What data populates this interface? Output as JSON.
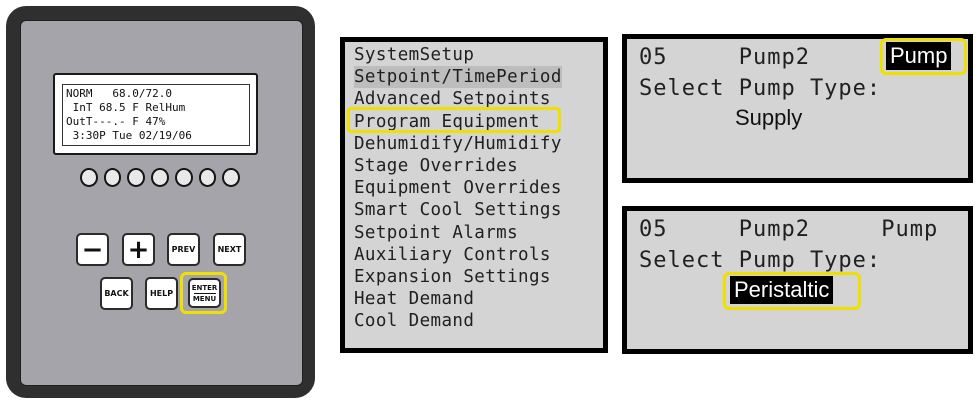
{
  "controller": {
    "lcd_lines": [
      "NORM   68.0/72.0",
      " InT 68.5 F RelHum",
      "OutT---.- F 47%",
      " 3:30P Tue 02/19/06"
    ],
    "led_count": 7,
    "keys": {
      "minus": "−",
      "plus": "+",
      "prev": "PREV",
      "next": "NEXT",
      "back": "BACK",
      "help": "HELP",
      "enter_top": "ENTER",
      "enter_bottom": "MENU"
    },
    "highlight_color": "#f0e000"
  },
  "menu_screen": {
    "items": [
      "SystemSetup",
      "Setpoint/TimePeriod",
      "Advanced Setpoints",
      "Program Equipment",
      "Dehumidify/Humidify",
      "Stage Overrides",
      "Equipment Overrides",
      "Smart Cool Settings",
      "Setpoint Alarms",
      "Auxiliary Controls",
      "Expansion Settings",
      "Heat Demand",
      "Cool Demand"
    ],
    "highlighted_item": "Program Equipment",
    "shaded_item": "Setpoint/TimePeriod"
  },
  "pump_screen_1": {
    "number": "05",
    "name": "Pump2",
    "field": "Pump",
    "prompt": "Select Pump Type:",
    "value": "Supply"
  },
  "pump_screen_2": {
    "number": "05",
    "name": "Pump2",
    "field": "Pump",
    "prompt": "Select Pump Type:",
    "value": "Peristaltic"
  }
}
